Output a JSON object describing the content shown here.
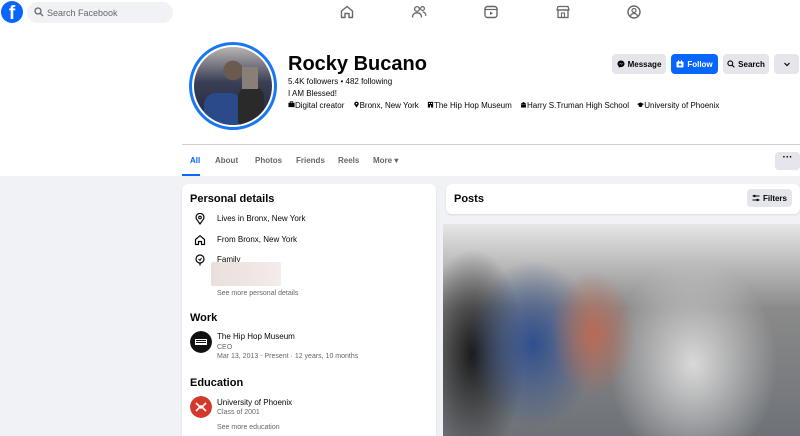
{
  "topbar": {
    "logo": "f",
    "search_placeholder": "Search Facebook",
    "nav_icons": [
      "home-icon",
      "friends-icon",
      "video-icon",
      "marketplace-icon",
      "groups-icon"
    ]
  },
  "profile": {
    "name": "Rocky Bucano",
    "follows": "5.4K followers • 482 following",
    "bio": "I AM Blessed!",
    "details": [
      {
        "icon": "briefcase-icon",
        "text": "Digital creator"
      },
      {
        "icon": "location-icon",
        "text": "Bronx, New York"
      },
      {
        "icon": "building-icon",
        "text": "The Hip Hop Museum"
      },
      {
        "icon": "school-icon",
        "text": "Harry S.Truman High School"
      },
      {
        "icon": "graduation-icon",
        "text": "University of Phoenix"
      }
    ]
  },
  "actions": {
    "message": "Message",
    "follow": "Follow",
    "search": "Search",
    "more": "⌄"
  },
  "tabs": [
    {
      "label": "All",
      "active": true
    },
    {
      "label": "About",
      "active": false
    },
    {
      "label": "Photos",
      "active": false
    },
    {
      "label": "Friends",
      "active": false
    },
    {
      "label": "Reels",
      "active": false
    },
    {
      "label": "More ▾",
      "active": false
    }
  ],
  "tabs_more": "···",
  "intro": {
    "personal_title": "Personal details",
    "lives_in": "Lives in Bronx, New York",
    "from": "From Bronx, New York",
    "family": "Family",
    "see_more_personal": "See more personal details",
    "work_title": "Work",
    "work": {
      "org": "The Hip Hop Museum",
      "role": "CEO",
      "dates": "Mar 13, 2013 - Present · 12 years, 10 months"
    },
    "education_title": "Education",
    "education": {
      "school": "University of Phoenix",
      "class": "Class of 2001"
    },
    "see_more_education": "See more education"
  },
  "posts": {
    "title": "Posts",
    "filters": "Filters"
  },
  "colors": {
    "brand_blue": "#0866ff",
    "background": "#f0f2f5",
    "button_gray": "#e4e6eb"
  }
}
